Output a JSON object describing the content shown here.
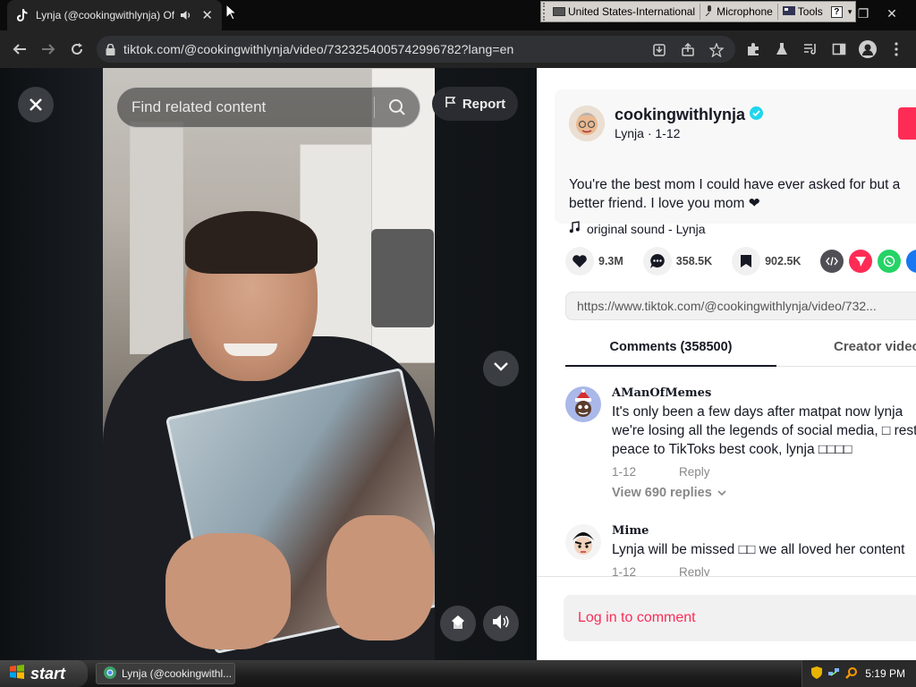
{
  "browser": {
    "tab_title": "Lynja (@cookingwithlynja) Official",
    "url": "tiktok.com/@cookingwithlynja/video/7323254005742996782?lang=en"
  },
  "language_bar": {
    "language": "United States-International",
    "microphone": "Microphone",
    "tools": "Tools"
  },
  "video": {
    "search_placeholder": "Find related content",
    "report_label": "Report"
  },
  "post": {
    "username": "cookingwithlynja",
    "display_name_date": "Lynja · 1-12",
    "caption": "You're the best mom I could have ever asked for but a better friend. I love you mom ❤",
    "sound": "original sound - Lynja",
    "likes": "9.3M",
    "comments": "358.5K",
    "saves": "902.5K",
    "link": "https://www.tiktok.com/@cookingwithlynja/video/732...",
    "colors": {
      "accent": "#fe2c55",
      "verified": "#20d5ec"
    }
  },
  "tabs": {
    "comments": "Comments (358500)",
    "creator": "Creator videos"
  },
  "comments": [
    {
      "name": "AManOfMemes",
      "text": "It's only been a few days after matpat now lynja we're losing all the legends of social media, □ rest in peace to TikToks best cook, lynja □□□□",
      "date": "1-12",
      "reply": "Reply",
      "replies": "View 690 replies"
    },
    {
      "name": "Mime",
      "text": "Lynja will be missed □□ we all loved her content",
      "date": "1-12",
      "reply": "Reply"
    }
  ],
  "login": {
    "label": "Log in to comment"
  },
  "taskbar": {
    "start": "start",
    "task_label": "Lynja (@cookingwithl...",
    "clock": "5:19 PM"
  }
}
